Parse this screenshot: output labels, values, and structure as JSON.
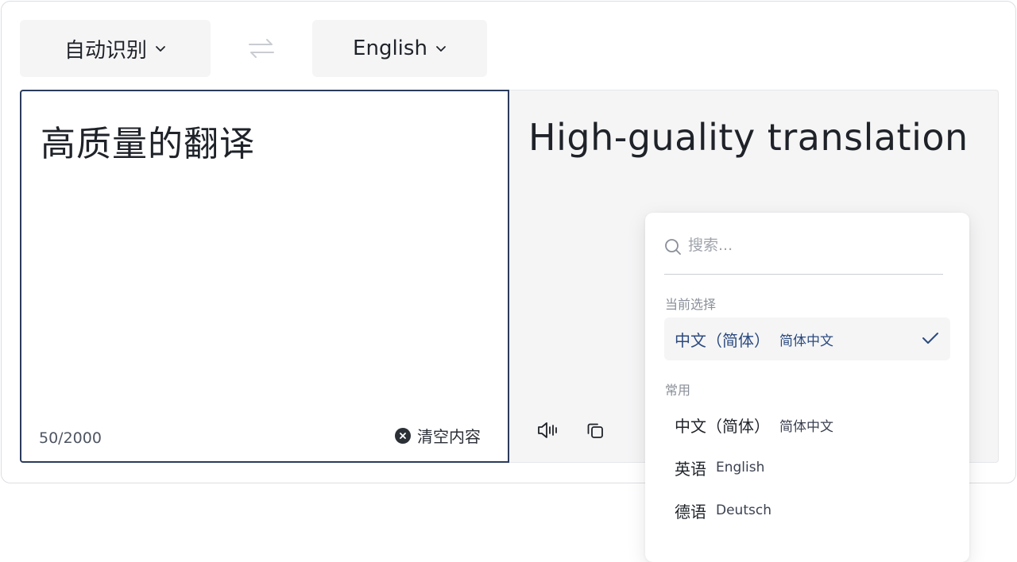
{
  "source_lang": {
    "label": "自动识别"
  },
  "target_lang": {
    "label": "English"
  },
  "source": {
    "text": "高质量的翻译",
    "count": "50/2000",
    "clear_label": "清空内容"
  },
  "target": {
    "text": "High-guality translation"
  },
  "dropdown": {
    "search_placeholder": "搜索...",
    "current_label": "当前选择",
    "current": {
      "name": "中文（简体）",
      "native": "简体中文"
    },
    "common_label": "常用",
    "common": [
      {
        "name": "中文（简体）",
        "native": "简体中文"
      },
      {
        "name": "英语",
        "native": "English"
      },
      {
        "name": "德语",
        "native": "Deutsch"
      }
    ]
  },
  "colors": {
    "accent": "#2b3b5c",
    "selected_text": "#2b4a7e",
    "panel_bg": "#f5f5f6"
  },
  "icons": {
    "chevron": "chevron-down-icon",
    "swap": "swap-arrows-icon",
    "clear": "clear-circle-icon",
    "speak": "speaker-icon",
    "copy": "copy-icon",
    "search": "search-icon",
    "check": "check-icon"
  }
}
